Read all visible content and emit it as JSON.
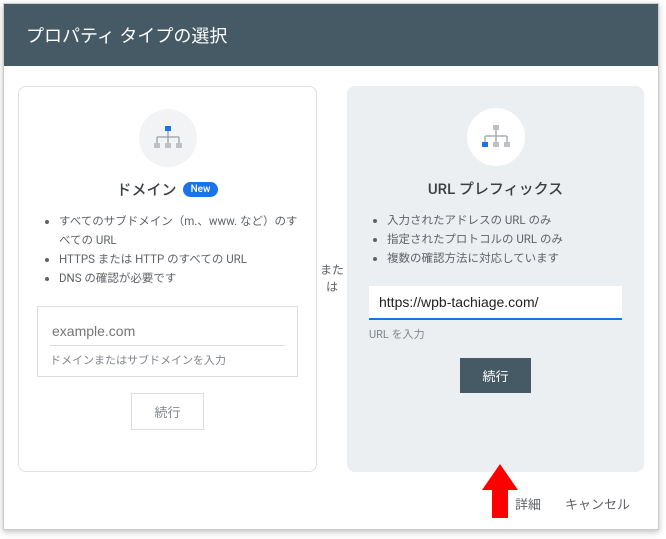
{
  "header": {
    "title": "プロパティ タイプの選択"
  },
  "or": "または",
  "left": {
    "title": "ドメイン",
    "badge": "New",
    "features": [
      "すべてのサブドメイン（m.、www. など）のすべての URL",
      "HTTPS または HTTP のすべての URL",
      "DNS の確認が必要です"
    ],
    "placeholder": "example.com",
    "input_label": "ドメインまたはサブドメインを入力",
    "button": "続行"
  },
  "right": {
    "title": "URL プレフィックス",
    "features": [
      "入力されたアドレスの URL のみ",
      "指定されたプロトコルの URL のみ",
      "複数の確認方法に対応しています"
    ],
    "value": "https://wpb-tachiage.com/",
    "input_label": "URL を入力",
    "button": "続行"
  },
  "footer": {
    "details": "詳細",
    "cancel": "キャンセル"
  }
}
